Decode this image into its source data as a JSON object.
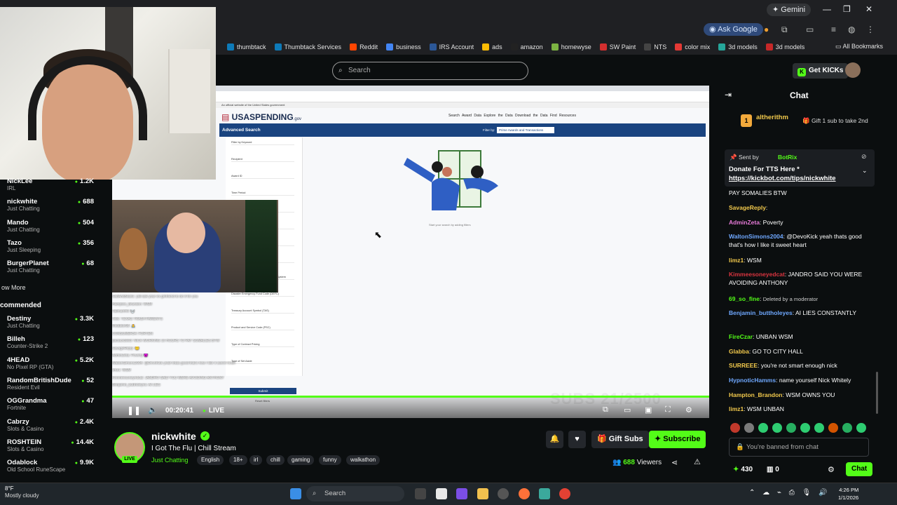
{
  "browser": {
    "gemini_label": "Gemini",
    "ask_google_label": "Ask Google",
    "bookmarks": [
      {
        "label": "thumbtack",
        "color": "#0d7ab8"
      },
      {
        "label": "Thumbtack Services",
        "color": "#0d7ab8"
      },
      {
        "label": "Reddit",
        "color": "#ff4500"
      },
      {
        "label": "business",
        "color": "#4285f4"
      },
      {
        "label": "IRS Account",
        "color": "#2b5797"
      },
      {
        "label": "ads",
        "color": "#fbbc04"
      },
      {
        "label": "amazon",
        "color": "#222222"
      },
      {
        "label": "homewyse",
        "color": "#7cb342"
      },
      {
        "label": "SW Paint",
        "color": "#d32f2f"
      },
      {
        "label": "NTS",
        "color": "#444444"
      },
      {
        "label": "color mix",
        "color": "#e53935"
      },
      {
        "label": "3d models",
        "color": "#26a69a"
      },
      {
        "label": "3d models",
        "color": "#c62828"
      }
    ],
    "all_bookmarks_label": "All Bookmarks"
  },
  "kick": {
    "search_placeholder": "Search",
    "get_kicks_label": "Get KICKs"
  },
  "sidebar": {
    "following": [
      {
        "name": "NickLee",
        "category": "IRL",
        "viewers": "1.2K"
      },
      {
        "name": "nickwhite",
        "category": "Just Chatting",
        "viewers": "688"
      },
      {
        "name": "Mando",
        "category": "Just Chatting",
        "viewers": "504"
      },
      {
        "name": "Tazo",
        "category": "Just Sleeping",
        "viewers": "356"
      },
      {
        "name": "BurgerPlanet",
        "category": "Just Chatting",
        "viewers": "68"
      }
    ],
    "show_more": "ow More",
    "recommended_title": "commended",
    "recommended": [
      {
        "name": "Destiny",
        "category": "Just Chatting",
        "viewers": "3.3K"
      },
      {
        "name": "Billeh",
        "category": "Counter-Strike 2",
        "viewers": "123"
      },
      {
        "name": "4HEAD",
        "category": "No Pixel RP (GTA)",
        "viewers": "5.2K"
      },
      {
        "name": "RandomBritishDude",
        "category": "Resident Evil",
        "viewers": "52"
      },
      {
        "name": "OGGrandma",
        "category": "Fortnite",
        "viewers": "47"
      },
      {
        "name": "Cabrzy",
        "category": "Slots & Casino",
        "viewers": "2.4K"
      },
      {
        "name": "ROSHTEIN",
        "category": "Slots & Casino",
        "viewers": "14.4K"
      },
      {
        "name": "Odablock",
        "category": "Old School RuneScape",
        "viewers": "9.9K"
      }
    ]
  },
  "stream": {
    "inner_site": {
      "logo": "USASPENDING",
      "logo_suffix": ".gov",
      "banner": "An official website of the United States government",
      "nav": "Search Award Data   Explore the Data   Download the Data   Find Resources",
      "section_title": "Advanced Search",
      "filter_by": "Filter by:",
      "filter_select": "Prime Awards and Transactions",
      "filter_lines": [
        "Filter by Keyword",
        "Recipient",
        "Award ID",
        "Time Period",
        "Fiscal years   Custom dates",
        "Award Description",
        "Award Amount",
        "Assistance Listing",
        "North American Industry Classification System",
        "Disaster Emergency Fund Code (DEFC)",
        "Treasury Account Symbol (TAS)",
        "Product and Service Code (PSC)",
        "Type of Contract Pricing",
        "Type of Set Aside"
      ],
      "start_text": "Start your search by adding filters",
      "submit": "Submit",
      "reset": "Reset filters"
    },
    "subs_watermark": "SUBS 21/2500",
    "overlay_chat": [
      "SaltAndBlast1: yall ask your ex girlfriend to do it for you",
      "Hampton_Brandon: WSM",
      "Tallmanfrill: 💀",
      "Teiki: TEXAS TRASH PARENTS",
      "Redditor98: 🙏",
      "CONSUMER34: FORTEN",
      "jtactack3003: NICK WORKING 16 HOURS TO PAY SOMALIES BTW",
      "SavageReply: 🙂",
      "AdminZeta: Poverty 😈",
      "WaltonSimons2004: @DevoKick yeah thats good that's how I like it sweet heart",
      "limz1: WSM",
      "Kimmeesoneyedcat: JANDRO SAID YOU WERE AVOIDING ANTHONY",
      "Benjamin_buttholeyes: AI LIES"
    ],
    "time": "00:20:41",
    "live_label": "LIVE"
  },
  "channel": {
    "name": "nickwhite",
    "title": "I Got The Flu | Chill Stream",
    "live_badge": "LIVE",
    "category": "Just Chatting",
    "tags": [
      "English",
      "18+",
      "irl",
      "chill",
      "gaming",
      "funny",
      "walkathon"
    ],
    "gift_subs_label": "Gift Subs",
    "subscribe_label": "Subscribe",
    "viewers_count": "688",
    "viewers_label": "Viewers"
  },
  "chat": {
    "title": "Chat",
    "gift": {
      "badge": "1",
      "user": "altherithm",
      "text": "Gift 1 sub to take 2nd"
    },
    "pinned": {
      "sent_by": "Sent by",
      "bot": "BotRix",
      "message": "Donate For TTS Here *",
      "link": "https://kickbot.com/tips/nickwhite"
    },
    "messages": [
      {
        "user": "",
        "color": "#ffffff",
        "text": "PAY SOMALIES BTW"
      },
      {
        "user": "SavageReply",
        "color": "#f2c94c",
        "text": ""
      },
      {
        "user": "AdminZeta",
        "color": "#e67ad8",
        "text": "Poverty"
      },
      {
        "user": "WaltonSimons2004",
        "color": "#6fa8ff",
        "text": "@DevoKick yeah thats good that's how I like it sweet heart"
      },
      {
        "user": "limz1",
        "color": "#f2c94c",
        "text": "WSM"
      },
      {
        "user": "Kimmeesoneyedcat",
        "color": "#d9343f",
        "text": "JANDRO SAID YOU WERE AVOIDING ANTHONY"
      },
      {
        "user": "69_so_fine",
        "color": "#53fc18",
        "text": "Deleted by a moderator"
      },
      {
        "user": "Benjamin_buttholeyes",
        "color": "#6fa8ff",
        "text": "AI LIES CONSTANTLY"
      },
      {
        "user": "FireCzar",
        "color": "#53fc18",
        "text": "UNBAN WSM"
      },
      {
        "user": "Glabba",
        "color": "#f2c94c",
        "text": "GO TO CITY HALL"
      },
      {
        "user": "SURREEE",
        "color": "#f2c94c",
        "text": "you're not smart enough nick"
      },
      {
        "user": "HypnoticHamms",
        "color": "#6fa8ff",
        "text": "name yourself Nick Whitely"
      },
      {
        "user": "Hampton_Brandon",
        "color": "#f2c94c",
        "text": "WSM OWNS YOU"
      },
      {
        "user": "limz1",
        "color": "#f2c94c",
        "text": "WSM UNBAN"
      }
    ],
    "banned_text": "You're banned from chat",
    "points": "430",
    "predictions": "0",
    "chat_button": "Chat"
  },
  "taskbar": {
    "temp": "8°F",
    "condition": "Mostly cloudy",
    "search_label": "Search",
    "time": "4:26 PM",
    "date": "1/1/2026"
  }
}
